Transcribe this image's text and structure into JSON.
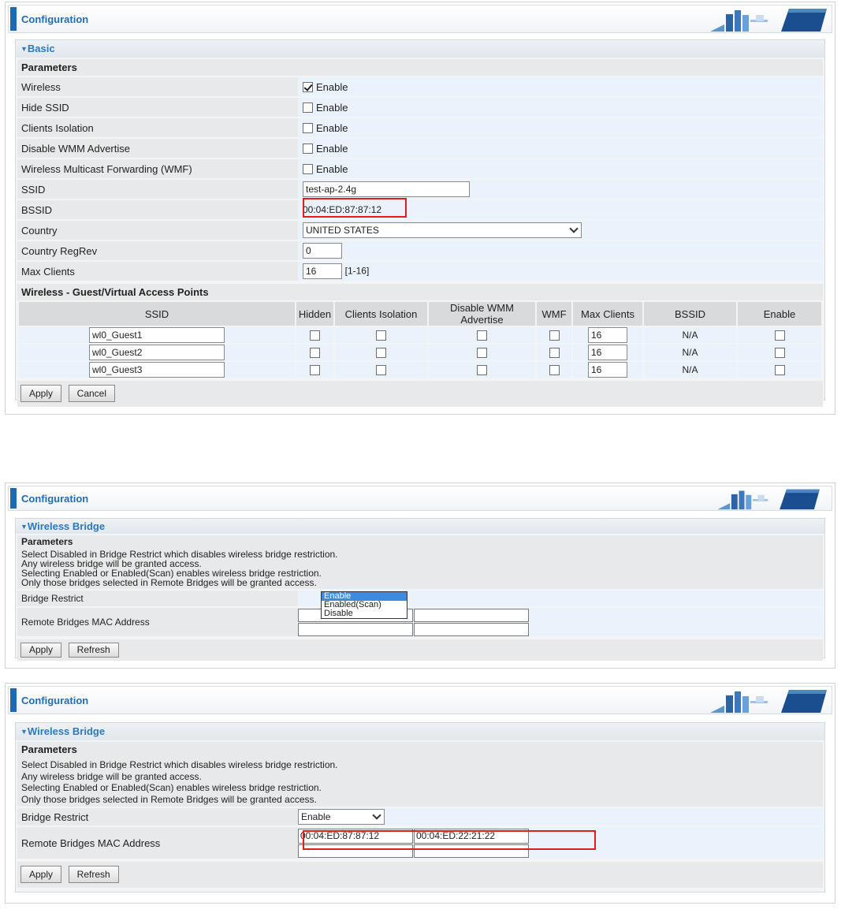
{
  "panel1": {
    "header_title": "Configuration",
    "section_title": "Basic",
    "params_heading": "Parameters",
    "enable_label": "Enable",
    "rows": {
      "wireless": {
        "label": "Wireless",
        "checked": true
      },
      "hide_ssid": {
        "label": "Hide SSID",
        "checked": false
      },
      "clients_isolation": {
        "label": "Clients Isolation",
        "checked": false
      },
      "disable_wmm": {
        "label": "Disable WMM Advertise",
        "checked": false
      },
      "wmf": {
        "label": "Wireless Multicast Forwarding (WMF)",
        "checked": false
      }
    },
    "ssid": {
      "label": "SSID",
      "value": "test-ap-2.4g"
    },
    "bssid": {
      "label": "BSSID",
      "value": "00:04:ED:87:87:12"
    },
    "country": {
      "label": "Country",
      "value": "UNITED STATES"
    },
    "country_regrev": {
      "label": "Country RegRev",
      "value": "0"
    },
    "max_clients": {
      "label": "Max Clients",
      "value": "16",
      "range": "[1-16]"
    },
    "guest_heading": "Wireless - Guest/Virtual Access Points",
    "guest_columns": [
      "SSID",
      "Hidden",
      "Clients Isolation",
      "Disable WMM Advertise",
      "WMF",
      "Max Clients",
      "BSSID",
      "Enable"
    ],
    "guest_rows": [
      {
        "ssid": "wl0_Guest1",
        "max_clients": "16",
        "bssid": "N/A"
      },
      {
        "ssid": "wl0_Guest2",
        "max_clients": "16",
        "bssid": "N/A"
      },
      {
        "ssid": "wl0_Guest3",
        "max_clients": "16",
        "bssid": "N/A"
      }
    ],
    "apply_label": "Apply",
    "cancel_label": "Cancel"
  },
  "panel2": {
    "header_title": "Configuration",
    "section_title": "Wireless Bridge",
    "params_heading": "Parameters",
    "info_lines": [
      "Select Disabled in Bridge Restrict which disables wireless bridge restriction.",
      "Any wireless bridge will be granted access.",
      "Selecting Enabled or Enabled(Scan) enables wireless bridge restriction.",
      "Only those bridges selected in Remote Bridges will be granted access."
    ],
    "bridge_restrict_label": "Bridge Restrict",
    "dropdown_options": [
      "Enable",
      "Enabled(Scan)",
      "Disable"
    ],
    "remote_label": "Remote Bridges MAC Address",
    "apply_label": "Apply",
    "refresh_label": "Refresh"
  },
  "panel3": {
    "header_title": "Configuration",
    "section_title": "Wireless Bridge",
    "params_heading": "Parameters",
    "info_lines": [
      "Select Disabled in Bridge Restrict which disables wireless bridge restriction.",
      "Any wireless bridge will be granted access.",
      "Selecting Enabled or Enabled(Scan) enables wireless bridge restriction.",
      "Only those bridges selected in Remote Bridges will be granted access."
    ],
    "bridge_restrict_label": "Bridge Restrict",
    "bridge_restrict_value": "Enable",
    "remote_label": "Remote Bridges MAC Address",
    "mac1": "00:04:ED:87:87:12",
    "mac2": "00:04:ED:22:21:22",
    "apply_label": "Apply",
    "refresh_label": "Refresh"
  },
  "colors": {
    "accent": "#1f6db5",
    "highlight_box": "#e01c1c",
    "label_bg": "#e8e9ea",
    "value_bg": "#eaf2fb"
  }
}
